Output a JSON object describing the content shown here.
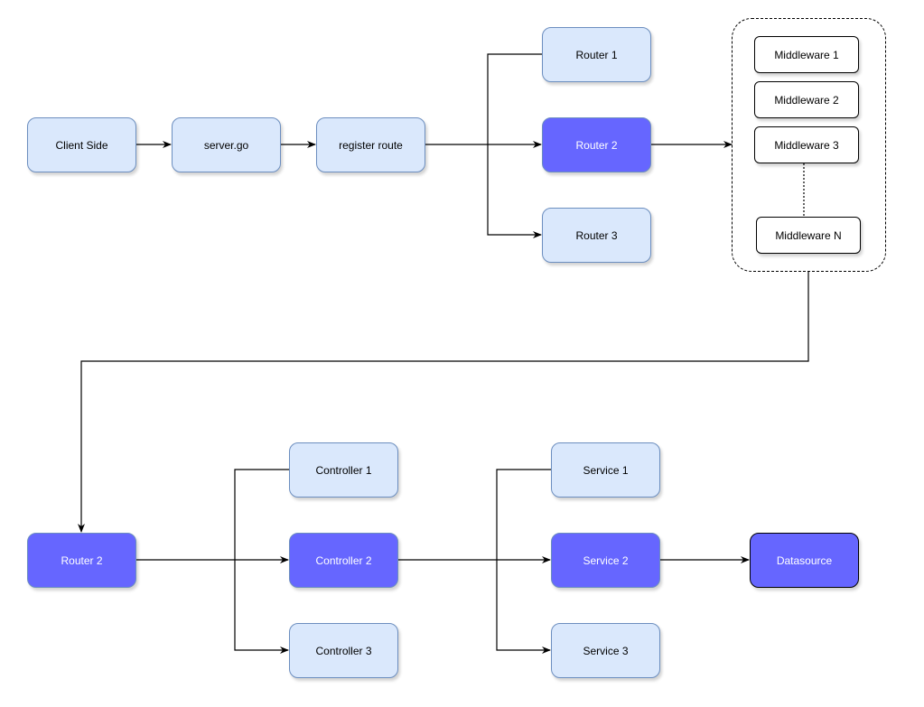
{
  "diagram": {
    "colors": {
      "light_fill": "#dae8fc",
      "light_stroke": "#6c8ebf",
      "highlight_fill": "#6666ff",
      "edge": "#000000"
    },
    "top_flow": {
      "client": "Client Side",
      "server": "server.go",
      "register": "register route",
      "routers": [
        "Router 1",
        "Router 2",
        "Router 3"
      ],
      "middleware_group": [
        "Middleware 1",
        "Middleware 2",
        "Middleware 3",
        "Middleware N"
      ]
    },
    "bottom_flow": {
      "router": "Router 2",
      "controllers": [
        "Controller 1",
        "Controller 2",
        "Controller 3"
      ],
      "services": [
        "Service 1",
        "Service 2",
        "Service 3"
      ],
      "datasource": "Datasource"
    },
    "edges": [
      {
        "from": "Client Side",
        "to": "server.go"
      },
      {
        "from": "server.go",
        "to": "register route"
      },
      {
        "from": "register route",
        "to": "Router 1"
      },
      {
        "from": "register route",
        "to": "Router 2"
      },
      {
        "from": "register route",
        "to": "Router 3"
      },
      {
        "from": "Router 2",
        "to": "Middleware group"
      },
      {
        "from": "Middleware 3",
        "to": "Middleware N",
        "style": "dotted"
      },
      {
        "from": "Middleware group",
        "to": "Router 2 (bottom)"
      },
      {
        "from": "Router 2 (bottom)",
        "to": "Controller 1"
      },
      {
        "from": "Router 2 (bottom)",
        "to": "Controller 2"
      },
      {
        "from": "Router 2 (bottom)",
        "to": "Controller 3"
      },
      {
        "from": "Controller 2",
        "to": "Service 1"
      },
      {
        "from": "Controller 2",
        "to": "Service 2"
      },
      {
        "from": "Controller 2",
        "to": "Service 3"
      },
      {
        "from": "Service 2",
        "to": "Datasource"
      }
    ]
  }
}
